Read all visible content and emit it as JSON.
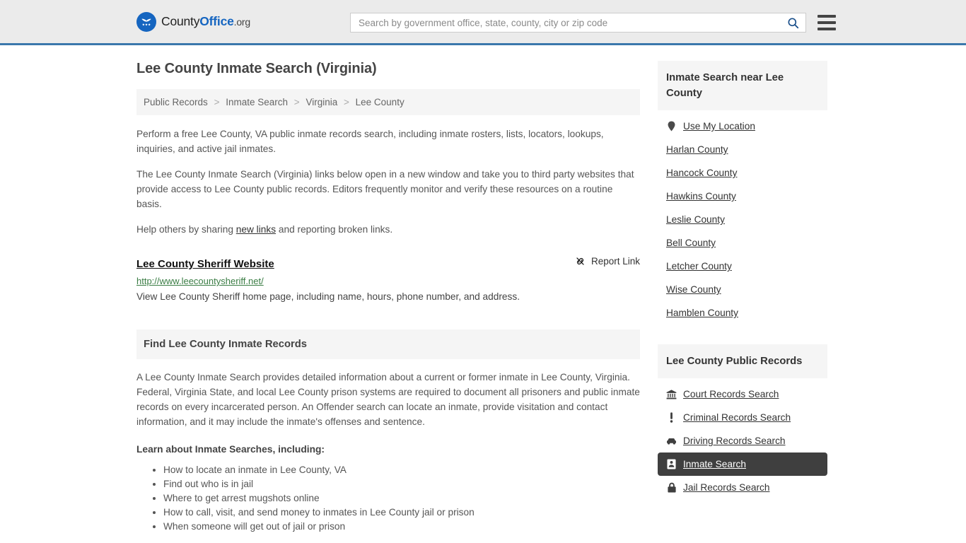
{
  "header": {
    "logo": {
      "icon": "eagle-shield-emblem",
      "text_part1": "County",
      "text_part2": "Office",
      "text_part3": ".org"
    },
    "search": {
      "placeholder": "Search by government office, state, county, city or zip code",
      "value": "",
      "search_icon": "search-icon"
    },
    "menu_icon": "hamburger-menu-icon",
    "accent_color": "#3a78ac",
    "background_color": "#ebebeb"
  },
  "page_title": "Lee County Inmate Search (Virginia)",
  "breadcrumb": {
    "separator": ">",
    "items": [
      {
        "label": "Public Records"
      },
      {
        "label": "Inmate Search"
      },
      {
        "label": "Virginia"
      },
      {
        "label": "Lee County"
      }
    ]
  },
  "intro": {
    "paragraph1": "Perform a free Lee County, VA public inmate records search, including inmate rosters, lists, locators, lookups, inquiries, and active jail inmates.",
    "paragraph2": "The Lee County Inmate Search (Virginia) links below open in a new window and take you to third party websites that provide access to Lee County public records. Editors frequently monitor and verify these resources on a routine basis.",
    "paragraph3_before": "Help others by sharing ",
    "paragraph3_link": "new links",
    "paragraph3_after": " and reporting broken links."
  },
  "link_result": {
    "title": "Lee County Sheriff Website",
    "url": "http://www.leecountysheriff.net/",
    "description": "View Lee County Sheriff home page, including name, hours, phone number, and address.",
    "report_label": "Report Link",
    "report_icon": "broken-link-icon",
    "url_color": "#3a7d44"
  },
  "records_section": {
    "heading": "Find Lee County Inmate Records",
    "body": "A Lee County Inmate Search provides detailed information about a current or former inmate in Lee County, Virginia. Federal, Virginia State, and local Lee County prison systems are required to document all prisoners and public inmate records on every incarcerated person. An Offender search can locate an inmate, provide visitation and contact information, and it may include the inmate's offenses and sentence.",
    "subheading": "Learn about Inmate Searches, including:",
    "bullets": [
      "How to locate an inmate in Lee County, VA",
      "Find out who is in jail",
      "Where to get arrest mugshots online",
      "How to call, visit, and send money to inmates in Lee County jail or prison",
      "When someone will get out of jail or prison"
    ]
  },
  "sidebar": {
    "nearby": {
      "heading": "Inmate Search near Lee County",
      "items": [
        {
          "label": "Use My Location",
          "icon": "map-pin-icon",
          "active": false
        },
        {
          "label": "Harlan County",
          "icon": "",
          "active": false
        },
        {
          "label": "Hancock County",
          "icon": "",
          "active": false
        },
        {
          "label": "Hawkins County",
          "icon": "",
          "active": false
        },
        {
          "label": "Leslie County",
          "icon": "",
          "active": false
        },
        {
          "label": "Bell County",
          "icon": "",
          "active": false
        },
        {
          "label": "Letcher County",
          "icon": "",
          "active": false
        },
        {
          "label": "Wise County",
          "icon": "",
          "active": false
        },
        {
          "label": "Hamblen County",
          "icon": "",
          "active": false
        }
      ]
    },
    "public_records": {
      "heading": "Lee County Public Records",
      "active_background": "#3f3f3f",
      "items": [
        {
          "label": "Court Records Search",
          "icon": "courthouse-icon",
          "active": false
        },
        {
          "label": "Criminal Records Search",
          "icon": "exclamation-icon",
          "active": false
        },
        {
          "label": "Driving Records Search",
          "icon": "car-icon",
          "active": false
        },
        {
          "label": "Inmate Search",
          "icon": "id-badge-icon",
          "active": true
        },
        {
          "label": "Jail Records Search",
          "icon": "lock-icon",
          "active": false
        }
      ]
    }
  }
}
